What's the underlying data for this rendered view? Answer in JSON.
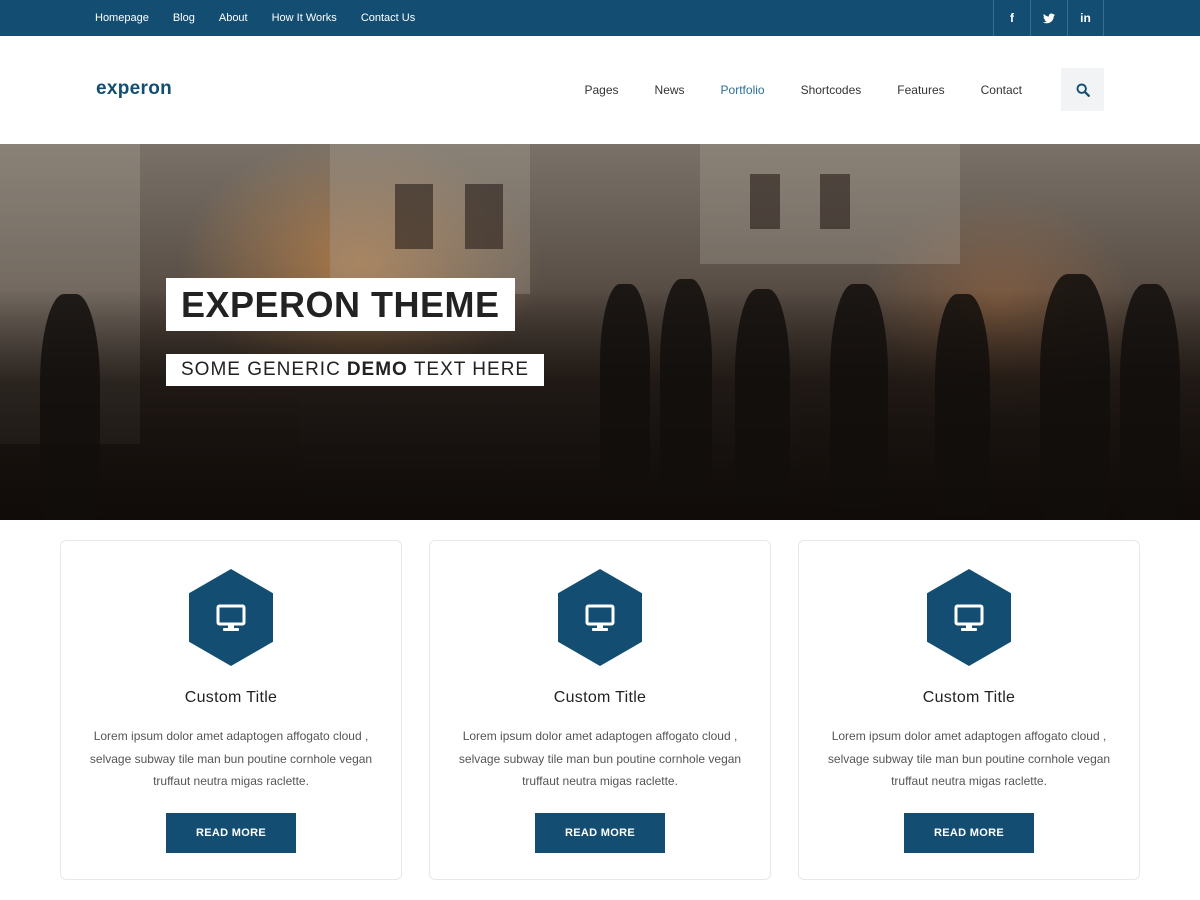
{
  "topbar": {
    "links": [
      "Homepage",
      "Blog",
      "About",
      "How It Works",
      "Contact Us"
    ],
    "social": [
      {
        "icon": "facebook-icon",
        "glyph": "f"
      },
      {
        "icon": "twitter-icon",
        "glyph": "t"
      },
      {
        "icon": "linkedin-icon",
        "glyph": "in"
      }
    ]
  },
  "header": {
    "logo": "experon",
    "nav": [
      "Pages",
      "News",
      "Portfolio",
      "Shortcodes",
      "Features",
      "Contact"
    ],
    "active_nav": "Portfolio",
    "search_icon": "search-icon"
  },
  "hero": {
    "title": "EXPERON THEME",
    "subtitle_pre": "SOME GENERIC",
    "subtitle_bold": "DEMO",
    "subtitle_post": "TEXT HERE"
  },
  "cards": [
    {
      "icon": "monitor-icon",
      "title": "Custom Title",
      "text": "Lorem ipsum dolor amet adaptogen affogato cloud , selvage subway tile man bun poutine cornhole vegan truffaut neutra migas raclette.",
      "button": "READ MORE"
    },
    {
      "icon": "monitor-icon",
      "title": "Custom Title",
      "text": "Lorem ipsum dolor amet adaptogen affogato cloud , selvage subway tile man bun poutine cornhole vegan truffaut neutra migas raclette.",
      "button": "READ MORE"
    },
    {
      "icon": "monitor-icon",
      "title": "Custom Title",
      "text": "Lorem ipsum dolor amet adaptogen affogato cloud , selvage subway tile man bun poutine cornhole vegan truffaut neutra migas raclette.",
      "button": "READ MORE"
    }
  ],
  "colors": {
    "brand": "#134e72",
    "active_link": "#2c6f97",
    "text": "#222222",
    "body_text": "#555555"
  }
}
